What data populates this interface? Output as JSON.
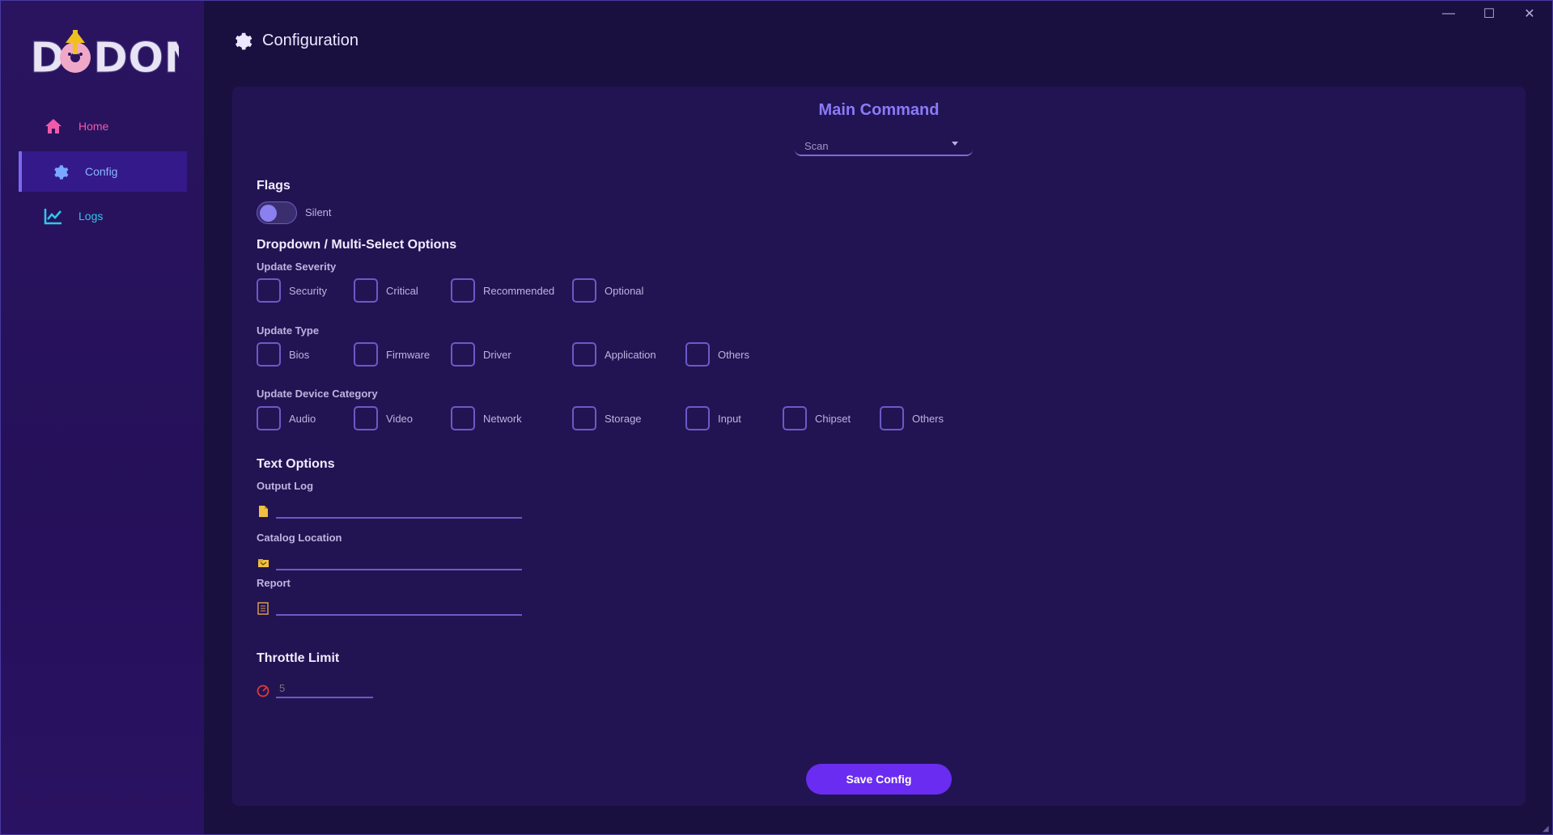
{
  "app": {
    "logo_text": "DONUT"
  },
  "window": {
    "minimize_glyph": "—",
    "maximize_glyph": "☐",
    "close_glyph": "✕"
  },
  "sidebar": {
    "items": [
      {
        "label": "Home",
        "icon": "home-icon",
        "color": "#f05aa8"
      },
      {
        "label": "Config",
        "icon": "gear-icon",
        "color": "#8ab8ff",
        "active": true
      },
      {
        "label": "Logs",
        "icon": "chart-line-icon",
        "color": "#2ec8e8"
      }
    ]
  },
  "header": {
    "title": "Configuration"
  },
  "main": {
    "command_title": "Main Command",
    "command_value": "Scan",
    "flags_title": "Flags",
    "silent_label": "Silent",
    "silent_on": false,
    "dropdown_title": "Dropdown / Multi-Select Options",
    "severity": {
      "title": "Update Severity",
      "options": [
        "Security",
        "Critical",
        "Recommended",
        "Optional"
      ]
    },
    "type": {
      "title": "Update Type",
      "options": [
        "Bios",
        "Firmware",
        "Driver",
        "Application",
        "Others"
      ]
    },
    "device": {
      "title": "Update Device Category",
      "options": [
        "Audio",
        "Video",
        "Network",
        "Storage",
        "Input",
        "Chipset",
        "Others"
      ]
    },
    "text_title": "Text Options",
    "output_log": {
      "label": "Output Log",
      "value": ""
    },
    "catalog": {
      "label": "Catalog Location",
      "value": ""
    },
    "report": {
      "label": "Report",
      "value": ""
    },
    "throttle": {
      "title": "Throttle Limit",
      "placeholder": "5"
    },
    "save_label": "Save Config"
  },
  "colors": {
    "accent": "#8a7af8",
    "button": "#6a2cf0",
    "panel": "#221452",
    "sidebar": "#2a1460"
  }
}
